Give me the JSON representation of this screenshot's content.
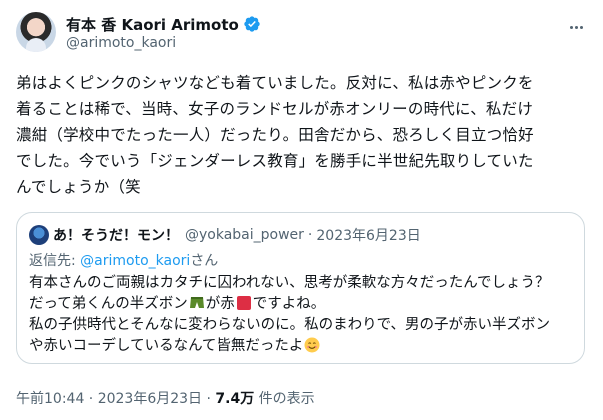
{
  "author": {
    "name": "有本 香 Kaori Arimoto",
    "handle": "@arimoto_kaori",
    "verified_color": "#1d9bf0"
  },
  "tweet": {
    "text": "弟はよくピンクのシャツなども着ていました。反対に、私は赤やピンクを\n着ることは稀で、当時、女子のランドセルが赤オンリーの時代に、私だけ\n濃紺（学校中でたった一人）だったり。田舎だから、恐ろしく目立つ恰好\nでした。今でいう「ジェンダーレス教育」を勝手に半世紀先取りしていた\nんでしょうか（笑"
  },
  "quote": {
    "name": "あ！そうだ！モン！",
    "handle": "@yokabai_power",
    "separator": "·",
    "date": "2023年6月23日",
    "reply_prefix": "返信先: ",
    "reply_mention": "@arimoto_kaori",
    "reply_suffix": "さん",
    "line1": "有本さんのご両親はカタチに囚われない、思考が柔軟な方々だったんでしょう？",
    "line2_a": "だって弟くんの半ズボン",
    "line2_b": "が赤",
    "line2_c": "ですよね。",
    "line3": "私の子供時代とそんなに変わらないのに。私のまわりで、男の子が赤い半ズボン",
    "line4": "や赤いコーデしているなんて皆無だったよ",
    "emoji_shorts": "green-shorts-icon",
    "emoji_red": "red-square-icon",
    "emoji_smile": "smiling-face-icon"
  },
  "meta": {
    "time_date": "午前10:44 · 2023年6月23日 · ",
    "views_count": "7.4万",
    "views_label": " 件の表示"
  },
  "colors": {
    "text": "#0f1419",
    "secondary": "#536471",
    "link": "#1d9bf0",
    "border": "#cfd9de"
  }
}
